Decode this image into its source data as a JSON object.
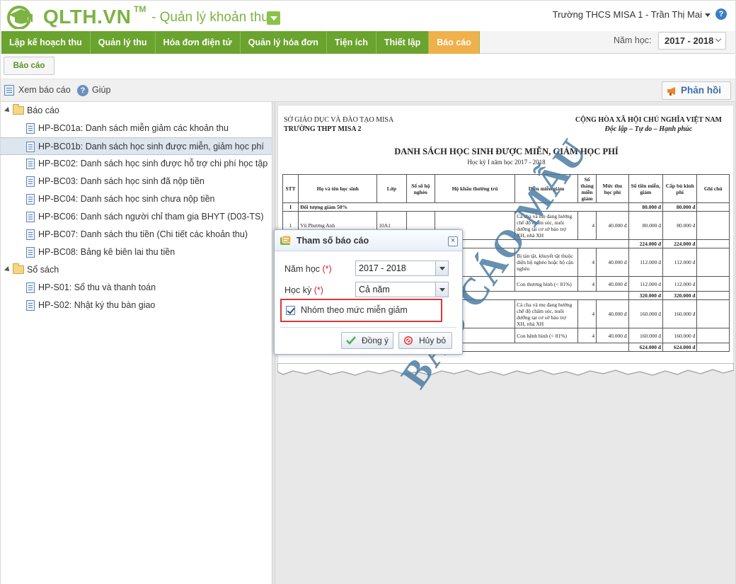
{
  "header": {
    "logo_text": "QLTH.VN",
    "logo_tm": "TM",
    "app_subtitle": "- Quản lý khoản thu",
    "user_info": "Trường THCS MISA 1 - Trần Thị Mai",
    "help_glyph": "?"
  },
  "nav": {
    "items": [
      "Lập kế hoạch thu",
      "Quản lý thu",
      "Hóa đơn điện tử",
      "Quản lý hóa đơn",
      "Tiện ích",
      "Thiết lập",
      "Báo cáo"
    ],
    "active": "Báo cáo",
    "year_label": "Năm học:",
    "year_value": "2017 - 2018"
  },
  "subbar": {
    "tab_label": "Báo cáo"
  },
  "toolbar": {
    "view_report": "Xem báo cáo",
    "help": "Giúp",
    "help_glyph": "?",
    "feedback": "Phản hồi"
  },
  "tree": {
    "group1": "Báo cáo",
    "items1": [
      "HP-BC01a: Danh sách miễn giảm các khoản thu",
      "HP-BC01b: Danh sách học sinh được miễn, giảm học phí",
      "HP-BC02: Danh sách học sinh được hỗ trợ chi phí học tập",
      "HP-BC03: Danh sách học sinh đã nộp tiền",
      "HP-BC04: Danh sách học sinh chưa nộp tiền",
      "HP-BC06: Danh sách người chỉ tham gia BHYT (D03-TS)",
      "HP-BC07: Danh sách thu tiền (Chi tiết các khoản thu)",
      "HP-BC08: Bảng kê biên lai thu tiền"
    ],
    "group2": "Sổ sách",
    "items2": [
      "HP-S01: Sổ thu và thanh toán",
      "HP-S02: Nhật ký thu bàn giao"
    ],
    "selected_index": 1
  },
  "report": {
    "org1": "SỞ GIÁO DỤC VÀ ĐÀO TẠO MISA",
    "org2": "TRƯỜNG THPT MISA 2",
    "nation1": "CỘNG HÒA XÃ HỘI CHỦ NGHĨA VIỆT NAM",
    "nation2": "Độc lập – Tự do – Hạnh phúc",
    "title": "DANH SÁCH HỌC SINH ĐƯỢC MIỄN, GIẢM HỌC PHÍ",
    "subtitle": "Học kỳ I năm học 2017 - 2018",
    "headers": [
      "STT",
      "Họ và tên học sinh",
      "Lớp",
      "Số sổ hộ nghèo",
      "Hộ khẩu thường trú",
      "Diện miễn giảm",
      "Số tháng miễn giảm",
      "Mức thu học phí",
      "Số tiền miễn, giảm",
      "Cấp bù kinh phí",
      "Ghi chú"
    ],
    "group_row": {
      "stt": "I",
      "label": "Đối tượng giảm 50%",
      "amount": "80.000 đ",
      "support": "80.000 đ"
    },
    "row1": {
      "stt": "1",
      "name": "Vũ Phương Anh",
      "class": "10A1",
      "reason": "Cả cha và mẹ đang hưởng chế độ chăm sóc, nuôi dưỡng tại cơ sở bảo trợ XH, nhà XH",
      "months": "4",
      "fee": "40.000 đ",
      "amount": "80.000 đ",
      "support": "80.000 đ"
    },
    "total1": {
      "amount": "224.000 đ",
      "support": "224.000 đ"
    },
    "row2": {
      "reason": "Bị tàn tật, khuyết tật thuộc diện hộ nghèo hoặc hộ cận nghèo",
      "months": "4",
      "fee": "40.000 đ",
      "amount": "112.000 đ",
      "support": "112.000 đ"
    },
    "row3": {
      "reason": "Con thương binh (< 81%)",
      "months": "4",
      "fee": "40.000 đ",
      "amount": "112.000 đ",
      "support": "112.000 đ"
    },
    "total2": {
      "amount": "320.000 đ",
      "support": "320.000 đ"
    },
    "row4": {
      "reason": "Cả cha và mẹ đang hưởng chế độ chăm sóc, nuôi dưỡng tại cơ sở bảo trợ XH, nhà XH",
      "months": "4",
      "fee": "40.000 đ",
      "amount": "160.000 đ",
      "support": "160.000 đ"
    },
    "row5": {
      "reason": "Con bệnh binh (< 81%)",
      "months": "4",
      "fee": "40.000 đ",
      "amount": "160.000 đ",
      "support": "160.000 đ"
    },
    "total3": {
      "amount": "624.000 đ",
      "support": "624.000 đ"
    },
    "watermark": "BÁO CÁO MẪU"
  },
  "dialog": {
    "title": "Tham số báo cáo",
    "close_glyph": "×",
    "year_label": "Năm học",
    "year_value": "2017 - 2018",
    "term_label": "Học kỳ",
    "term_value": "Cả năm",
    "required_mark": "(*)",
    "group_checkbox_label": "Nhóm theo mức miễn giảm",
    "group_checked": true,
    "ok_label": "Đồng ý",
    "cancel_label": "Hủy bỏ"
  },
  "colors": {
    "brand_green": "#7cb342",
    "nav_green": "#6aa32e",
    "nav_active": "#f0b04a",
    "highlight_red": "#d9383a",
    "watermark": "#4678a0"
  }
}
